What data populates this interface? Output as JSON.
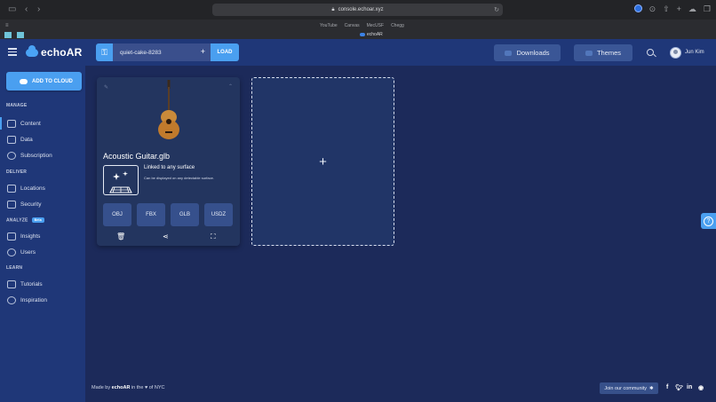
{
  "browser": {
    "url": "console.echoar.xyz",
    "favorites": [
      "YouTube",
      "Canvas",
      "MecUSF",
      "Chegg"
    ],
    "active_tab": "echoAR"
  },
  "header": {
    "logo_text": "echoAR",
    "api_key": "quiet-cake-8283",
    "load_label": "LOAD",
    "downloads_label": "Downloads",
    "themes_label": "Themes",
    "user_name": "Jun Kim"
  },
  "sidebar": {
    "add_cloud_label": "ADD TO CLOUD",
    "sections": {
      "manage": "MANAGE",
      "deliver": "DELIVER",
      "analyze": "ANALYZE",
      "beta": "Beta",
      "learn": "LEARN"
    },
    "items": {
      "content": "Content",
      "data": "Data",
      "subscription": "Subscription",
      "locations": "Locations",
      "security": "Security",
      "insights": "Insights",
      "users": "Users",
      "tutorials": "Tutorials",
      "inspiration": "Inspiration"
    }
  },
  "card": {
    "title": "Acoustic Guitar.glb",
    "surface_title": "Linked to any surface",
    "surface_subtitle": "Can be displayed on any detectable surface.",
    "formats": [
      "OBJ",
      "FBX",
      "GLB",
      "USDZ"
    ]
  },
  "add_box": {
    "symbol": "+"
  },
  "help": {
    "symbol": "?"
  },
  "footer": {
    "made_by": "Made by",
    "brand": "echoAR",
    "in_the": "in the",
    "heart": "♥",
    "of_nyc": "of NYC",
    "community_label": "Join our community"
  }
}
